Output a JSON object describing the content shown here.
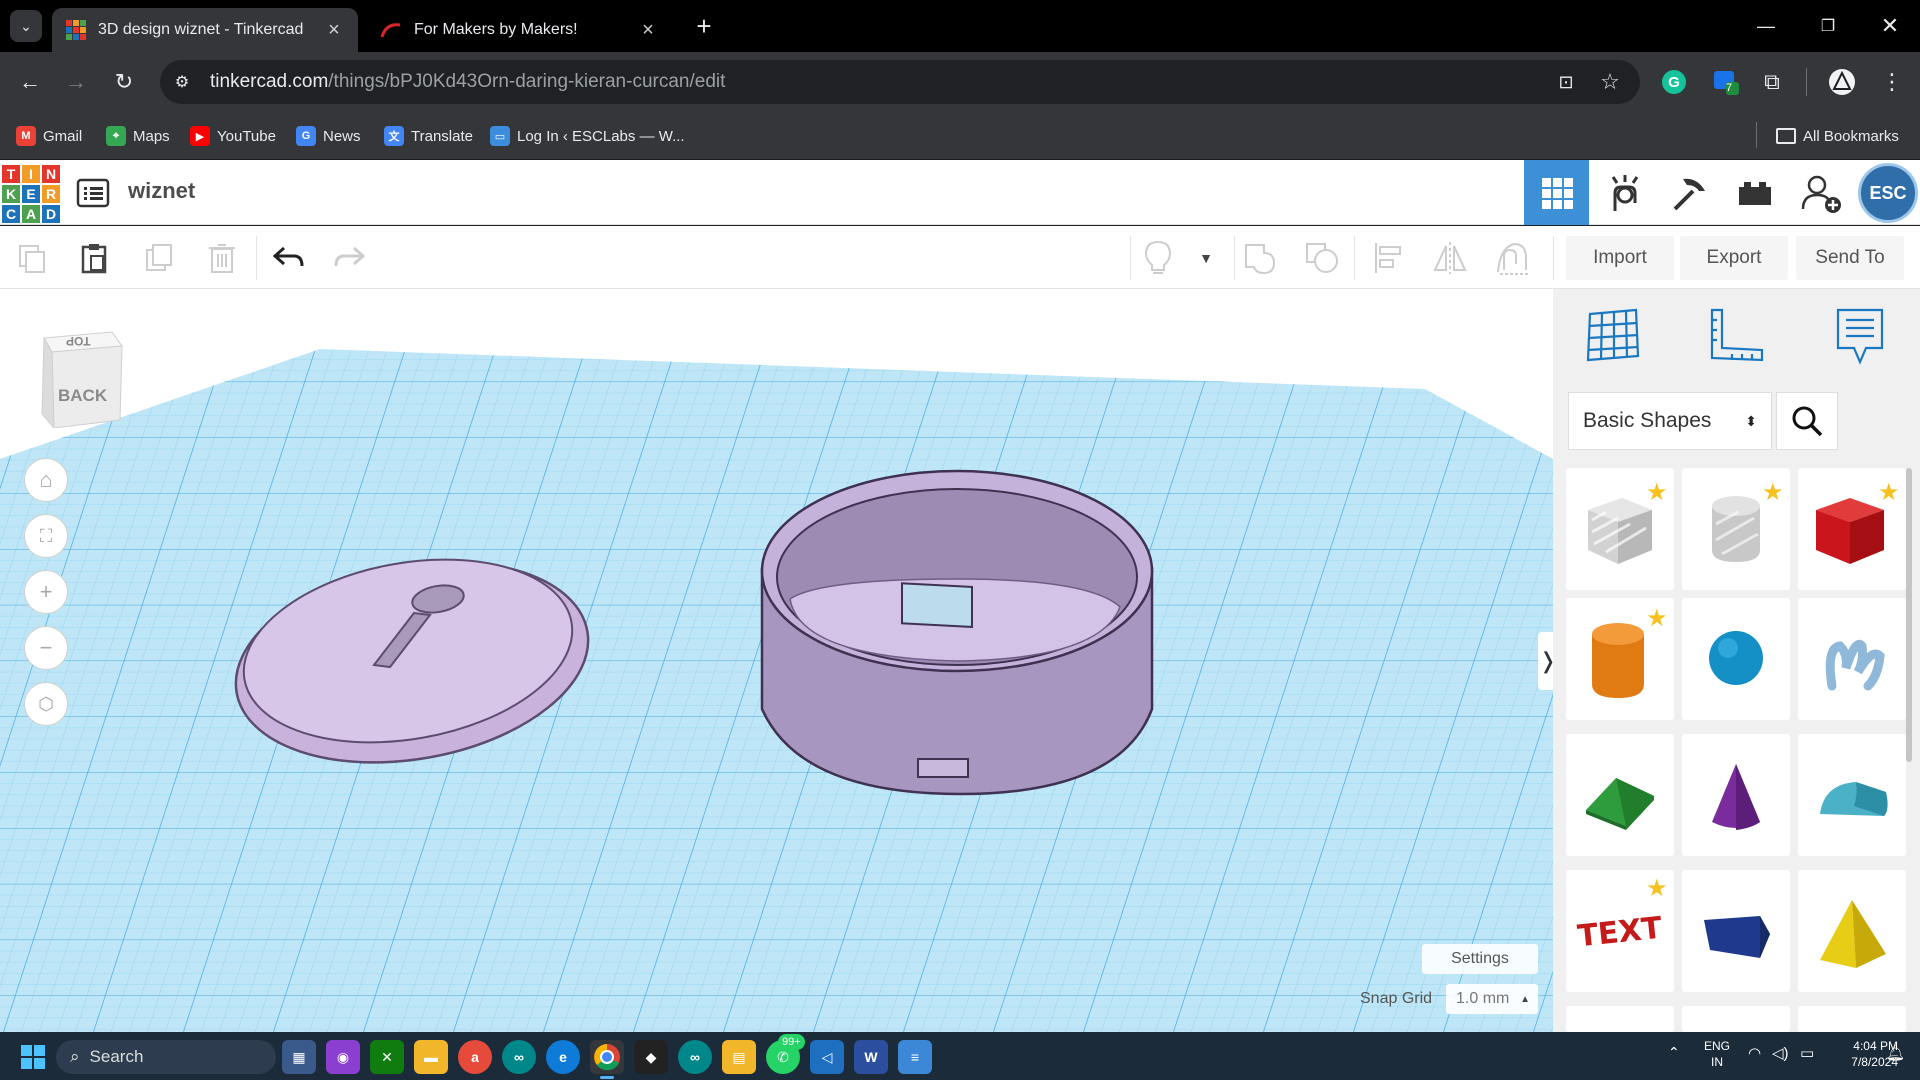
{
  "browser": {
    "tabs": [
      {
        "title": "3D design wiznet - Tinkercad",
        "active": true
      },
      {
        "title": "For Makers by Makers!",
        "active": false
      }
    ],
    "new_tab": "+",
    "url_domain": "tinkercad.com",
    "url_path": "/things/bPJ0Kd43Orn-daring-kieran-curcan/edit",
    "extension_badge": "7",
    "bookmarks": [
      {
        "label": "Gmail",
        "icon": "gmail-icon",
        "color": "#ea4335"
      },
      {
        "label": "Maps",
        "icon": "maps-icon",
        "color": "#34a853"
      },
      {
        "label": "YouTube",
        "icon": "youtube-icon",
        "color": "#ff0000"
      },
      {
        "label": "News",
        "icon": "news-icon",
        "color": "#4285f4"
      },
      {
        "label": "Translate",
        "icon": "translate-icon",
        "color": "#4285f4"
      },
      {
        "label": "Log In ‹ ESCLabs — W...",
        "icon": "esclabs-icon",
        "color": "#3c8dde"
      }
    ],
    "all_bookmarks": "All Bookmarks"
  },
  "tinkercad": {
    "logo_letters": [
      "T",
      "I",
      "N",
      "K",
      "E",
      "R",
      "C",
      "A",
      "D"
    ],
    "logo_colors": [
      "#e4352b",
      "#f29b26",
      "#e4352b",
      "#4da050",
      "#1d73ba",
      "#f29b26",
      "#1d73ba",
      "#4da050",
      "#1d73ba"
    ],
    "design_name": "wiznet",
    "header_buttons": [
      "3d-view-icon",
      "simulate-icon",
      "build-icon",
      "bricks-icon",
      "invite-user-icon"
    ],
    "user_avatar": "ESC",
    "toolbar_buttons": {
      "import": "Import",
      "export": "Export",
      "send_to": "Send To"
    },
    "viewcube": {
      "top": "TOP",
      "back": "BACK"
    },
    "shape_library": {
      "selected": "Basic Shapes"
    },
    "shapes": [
      {
        "name": "Box Hole",
        "favorite": true
      },
      {
        "name": "Cylinder Hole",
        "favorite": true
      },
      {
        "name": "Box",
        "favorite": true
      },
      {
        "name": "Cylinder",
        "favorite": true
      },
      {
        "name": "Sphere",
        "favorite": false
      },
      {
        "name": "Scribble",
        "favorite": false
      },
      {
        "name": "Roof",
        "favorite": false
      },
      {
        "name": "Cone",
        "favorite": false
      },
      {
        "name": "Round Roof",
        "favorite": false
      },
      {
        "name": "Text",
        "favorite": true
      },
      {
        "name": "Polygon",
        "favorite": false
      },
      {
        "name": "Pyramid",
        "favorite": false
      }
    ],
    "panel_toggle": "❭",
    "settings": "Settings",
    "snap_grid_label": "Snap Grid",
    "snap_grid_value": "1.0 mm",
    "accent_color": "#1a78c2"
  },
  "taskbar": {
    "search": "Search",
    "lang_top": "ENG",
    "lang_bottom": "IN",
    "time": "4:04 PM",
    "date": "7/8/2024",
    "whatsapp_badge": "99+"
  }
}
